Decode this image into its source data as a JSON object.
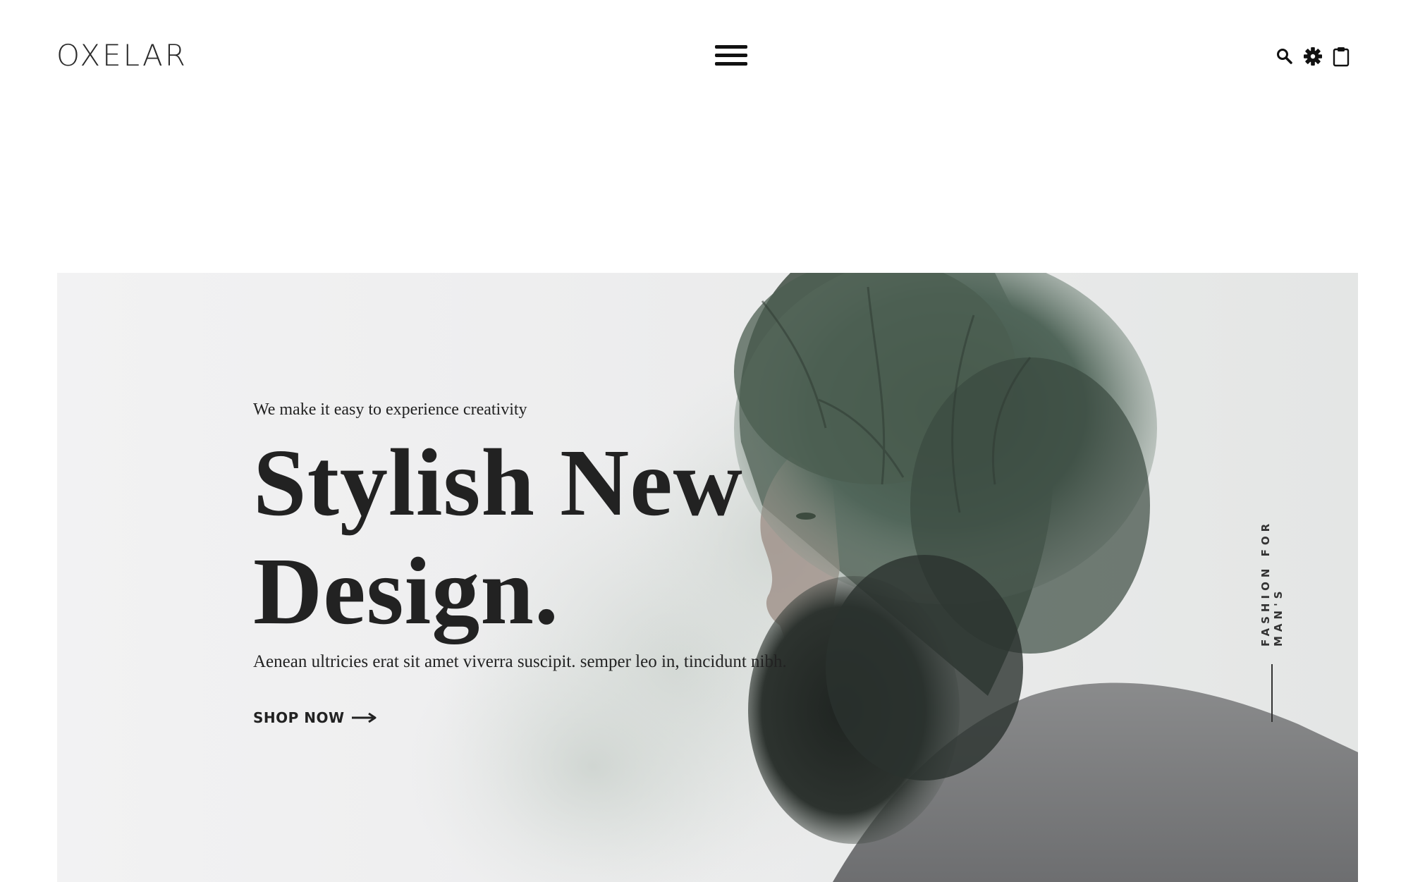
{
  "header": {
    "logo": "OXELAR",
    "icons": [
      "hamburger-menu-icon",
      "search-icon",
      "gear-icon",
      "clipboard-icon"
    ]
  },
  "hero": {
    "kicker": "We make it easy to experience creativity",
    "title_line1": "Stylish New",
    "title_line2": "Design.",
    "description": "Aenean ultricies erat sit amet viverra suscipit. semper leo in, tincidunt nibh.",
    "cta_label": "SHOP NOW",
    "side_label": "FASHION FOR MAN'S"
  },
  "colors": {
    "text": "#222222",
    "hero_background": "#f2f2f3"
  }
}
